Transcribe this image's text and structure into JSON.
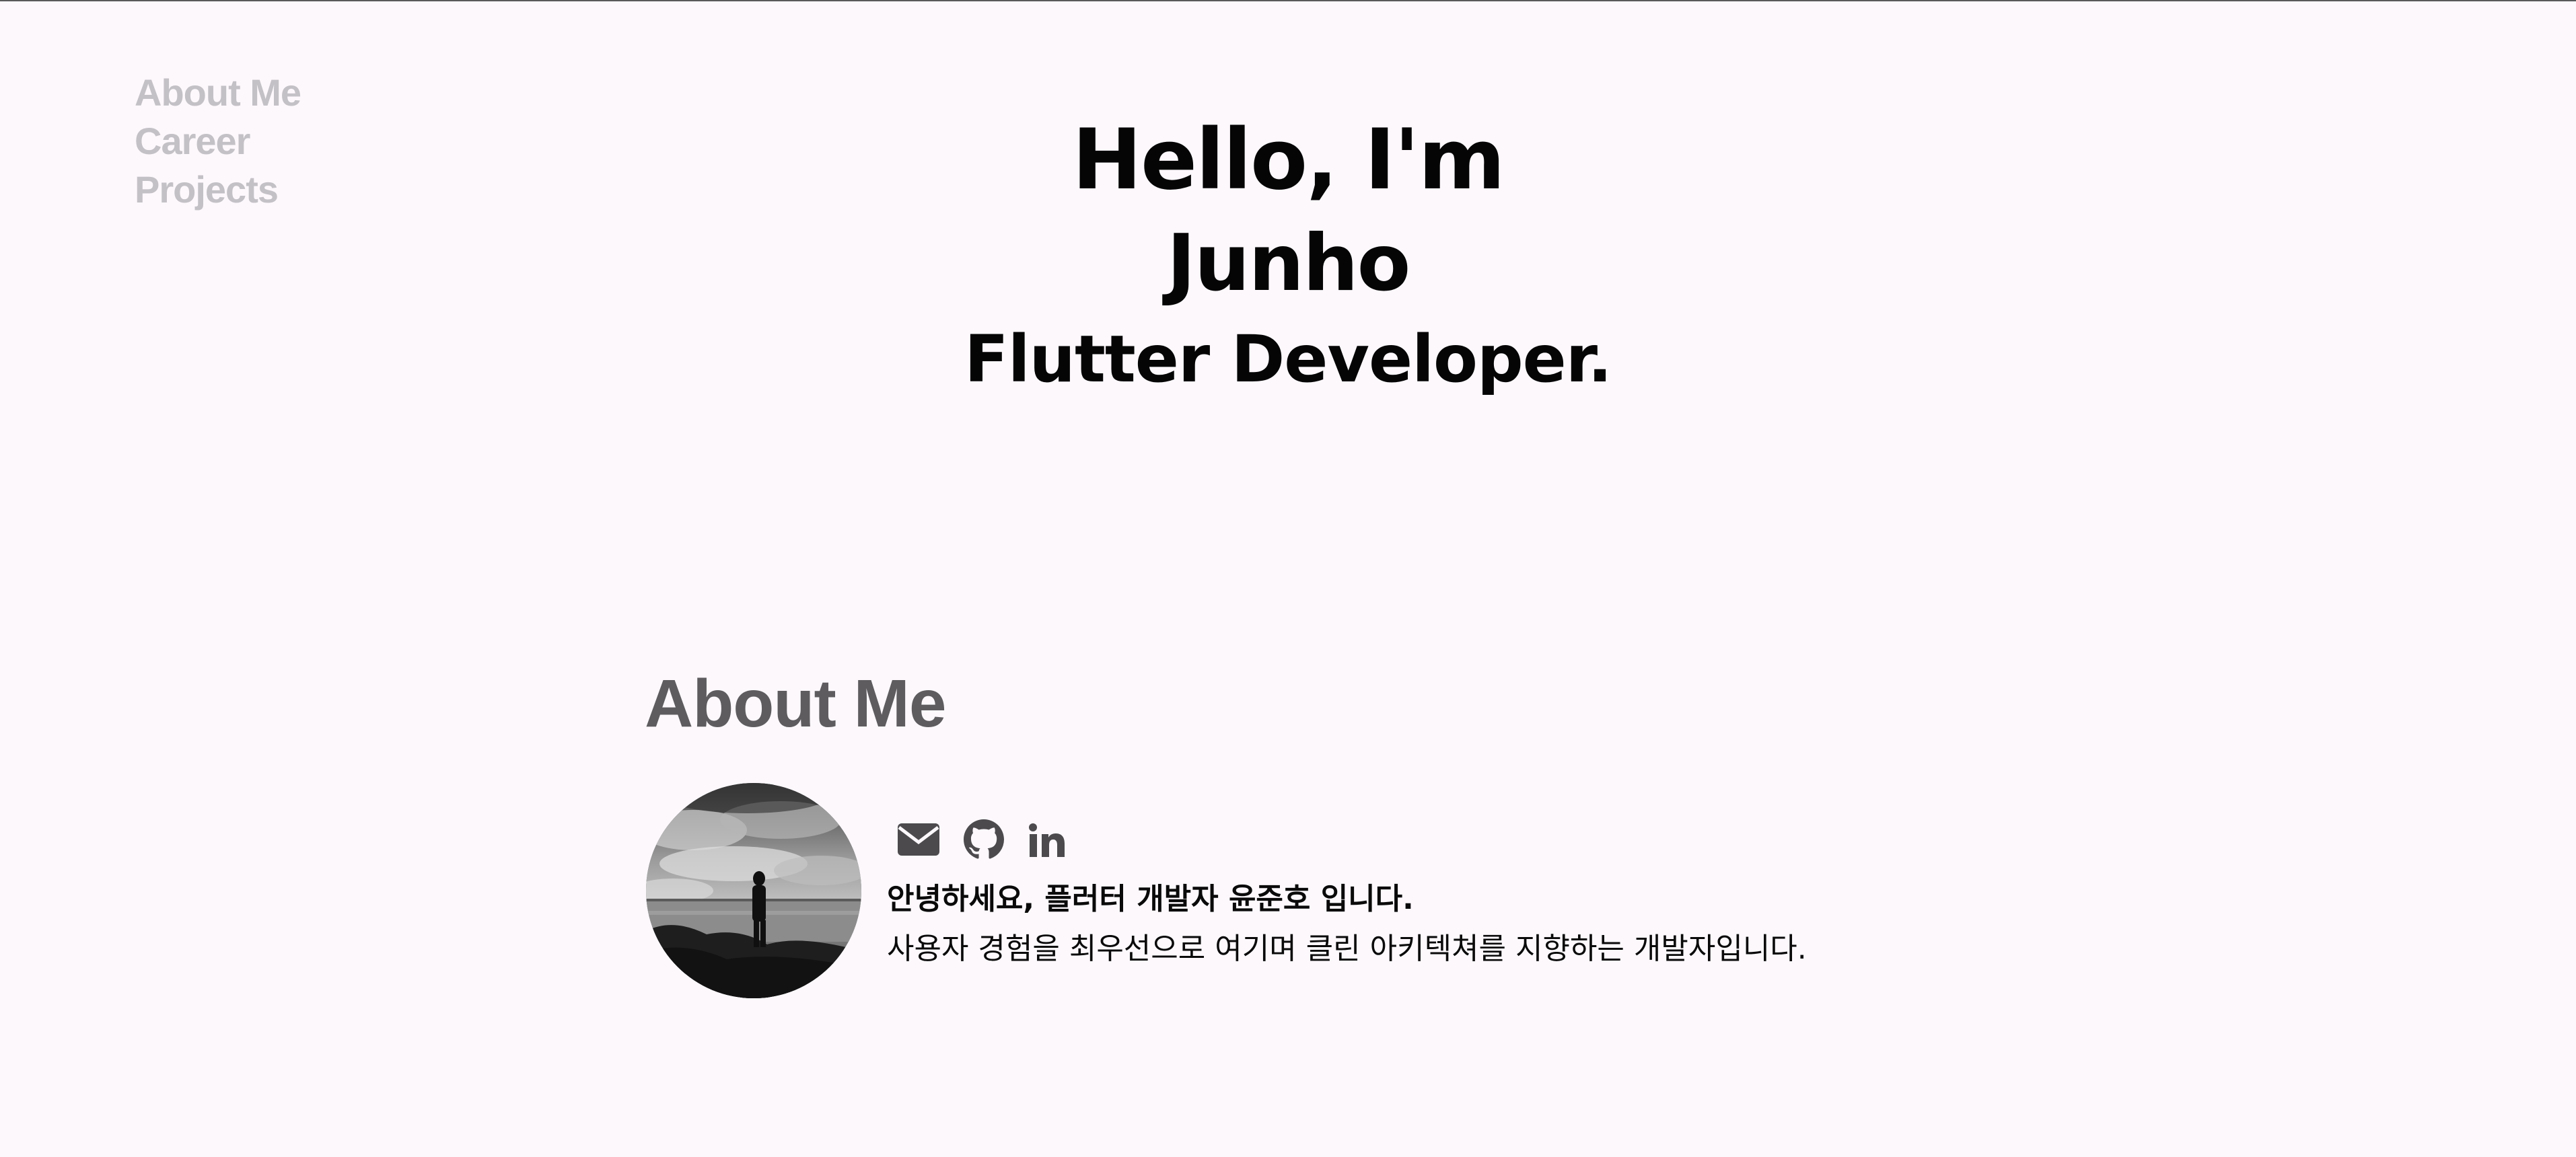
{
  "nav": {
    "items": [
      {
        "label": "About Me"
      },
      {
        "label": "Career"
      },
      {
        "label": "Projects"
      }
    ]
  },
  "hero": {
    "greeting": "Hello, I'm",
    "name": "Junho",
    "role": "Flutter Developer."
  },
  "about": {
    "heading": "About Me",
    "avatar_icon": "profile-photo",
    "socials": [
      {
        "icon": "envelope-icon"
      },
      {
        "icon": "github-icon"
      },
      {
        "icon": "linkedin-icon"
      }
    ],
    "bio_line1": "안녕하세요, 플러터 개발자 윤준호 입니다.",
    "bio_line2": "사용자 경험을 최우선으로 여기며 클린 아키텍쳐를 지향하는 개발자입니다."
  },
  "colors": {
    "background": "#fcf8fc",
    "nav_text": "#c4c1c6",
    "heading": "#5e5c5f",
    "text": "#050505"
  }
}
